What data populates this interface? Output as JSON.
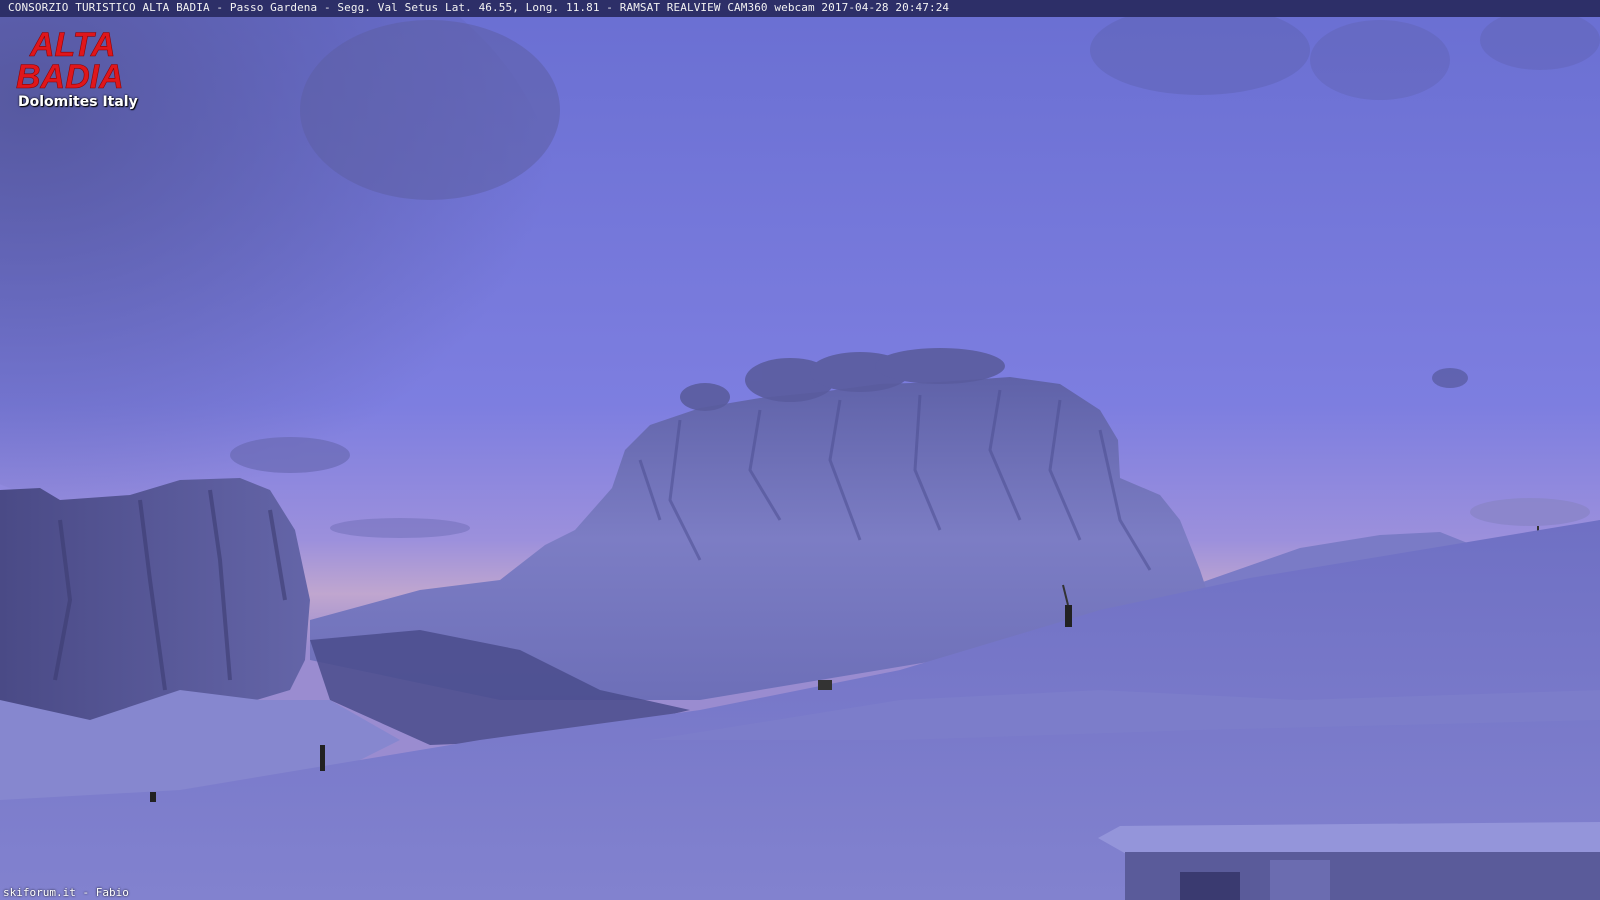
{
  "overlay": {
    "caption": "CONSORZIO TURISTICO ALTA BADIA - Passo Gardena - Segg. Val Setus  Lat. 46.55, Long. 11.81 - RAMSAT REALVIEW CAM360 webcam 2017-04-28 20:47:24",
    "credit": "skiforum.it - Fabio"
  },
  "logo": {
    "line1": "ALTA",
    "line2": "BADIA",
    "subtitle": "Dolomites Italy"
  },
  "colors": {
    "sky_top": "#6a6ed0",
    "sky_bottom": "#b69ccc",
    "snow": "#7777c4",
    "rock": "#4a4a8a",
    "logo_red": "#e0161b",
    "caption_bar": "#2d2f68"
  }
}
